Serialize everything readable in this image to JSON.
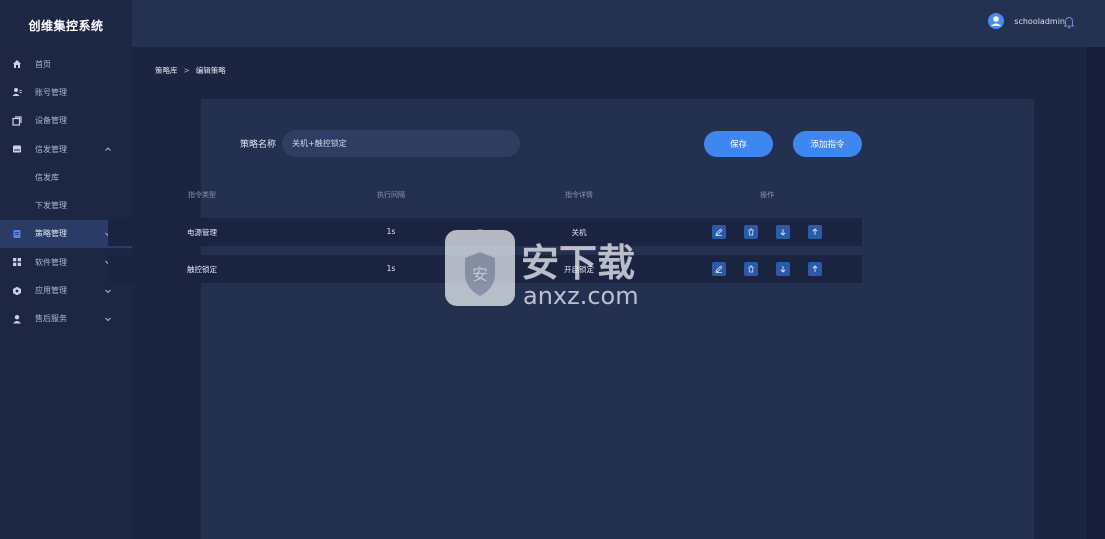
{
  "app": {
    "title": "创维集控系统"
  },
  "sidebar": {
    "items": [
      {
        "label": "首页",
        "icon": "home-icon"
      },
      {
        "label": "账号管理",
        "icon": "user-manage-icon"
      },
      {
        "label": "设备管理",
        "icon": "device-icon"
      },
      {
        "label": "信发管理",
        "icon": "publish-icon",
        "expanded": true
      },
      {
        "label": "信发库",
        "sub": true
      },
      {
        "label": "下发管理",
        "sub": true
      },
      {
        "label": "策略管理",
        "icon": "strategy-icon",
        "active": true
      },
      {
        "label": "软件管理",
        "icon": "apps-icon"
      },
      {
        "label": "应用管理",
        "icon": "app-manage-icon"
      },
      {
        "label": "售后服务",
        "icon": "service-icon"
      }
    ]
  },
  "header": {
    "username": "schooladmin"
  },
  "breadcrumb": {
    "parent": "策略库",
    "separator": ">",
    "current": "编辑策略"
  },
  "form": {
    "name_label": "策略名称",
    "name_value": "关机+触控锁定"
  },
  "buttons": {
    "save": "保存",
    "add_command": "添加指令"
  },
  "table": {
    "columns": [
      "指令类型",
      "执行间隔",
      "指令详情",
      "操作"
    ],
    "rows": [
      {
        "type": "电源管理",
        "interval": "1s",
        "detail": "关机"
      },
      {
        "type": "触控锁定",
        "interval": "1s",
        "detail": "开启锁定"
      }
    ]
  },
  "watermark": {
    "text": "安下载",
    "sub": "anxz.com"
  },
  "colors": {
    "accent": "#3f87f0",
    "sidebar": "#1d2743",
    "panel": "#243050"
  }
}
